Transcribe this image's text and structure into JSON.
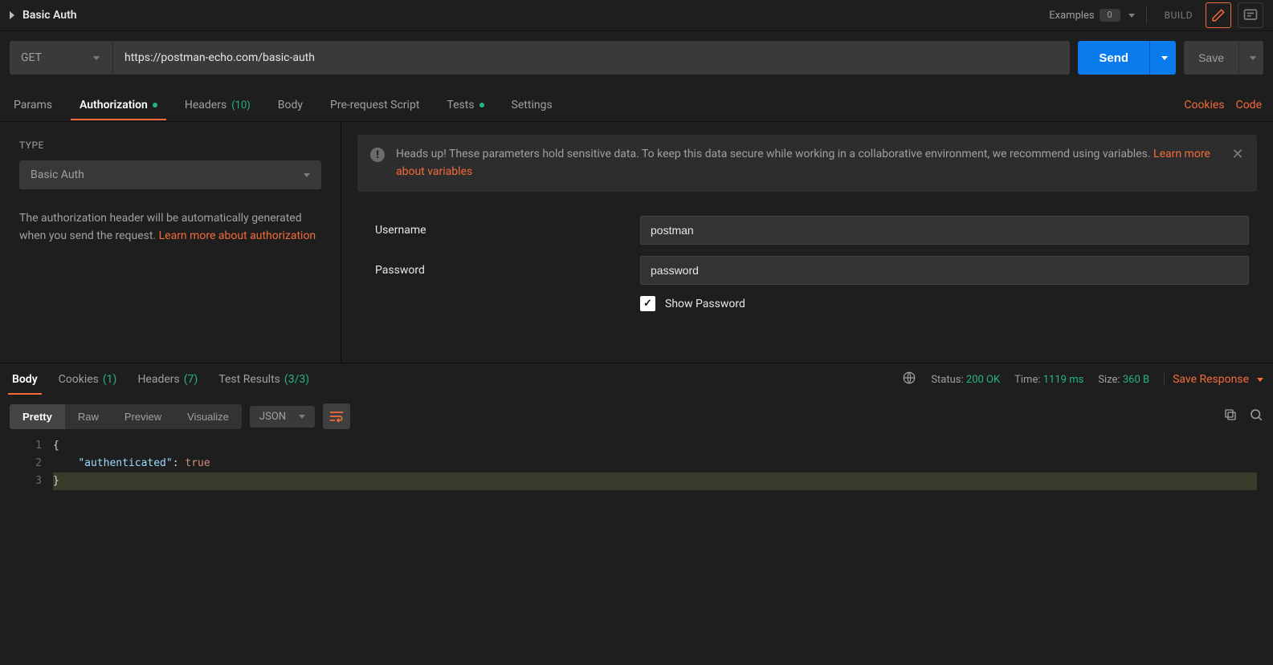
{
  "titlebar": {
    "request_name": "Basic Auth",
    "examples_label": "Examples",
    "examples_count": "0",
    "build": "BUILD"
  },
  "url_row": {
    "method": "GET",
    "url": "https://postman-echo.com/basic-auth",
    "send": "Send",
    "save": "Save"
  },
  "req_tabs": {
    "params": "Params",
    "authorization": "Authorization",
    "headers": "Headers",
    "headers_count": "(10)",
    "body": "Body",
    "prerequest": "Pre-request Script",
    "tests": "Tests",
    "settings": "Settings",
    "cookies": "Cookies",
    "code": "Code"
  },
  "auth_panel": {
    "type_label": "TYPE",
    "type_value": "Basic Auth",
    "help_text": "The authorization header will be automatically generated when you send the request. ",
    "learn_more": "Learn more about authorization"
  },
  "warning": {
    "text": "Heads up! These parameters hold sensitive data. To keep this data secure while working in a collaborative environment, we recommend using variables. ",
    "link": "Learn more about variables"
  },
  "form": {
    "username_label": "Username",
    "username_value": "postman",
    "password_label": "Password",
    "password_value": "password",
    "show_password": "Show Password"
  },
  "resp_tabs": {
    "body": "Body",
    "cookies": "Cookies",
    "cookies_count": "(1)",
    "headers": "Headers",
    "headers_count": "(7)",
    "tests": "Test Results",
    "tests_count": "(3/3)"
  },
  "resp_meta": {
    "status_k": "Status:",
    "status_v": "200 OK",
    "time_k": "Time:",
    "time_v": "1119 ms",
    "size_k": "Size:",
    "size_v": "360 B",
    "save_response": "Save Response"
  },
  "body_toolbar": {
    "pretty": "Pretty",
    "raw": "Raw",
    "preview": "Preview",
    "visualize": "Visualize",
    "format": "JSON"
  },
  "code": {
    "line1": "{",
    "line2_key": "\"authenticated\"",
    "line2_colon": ": ",
    "line2_val": "true",
    "line3": "}",
    "ln1": "1",
    "ln2": "2",
    "ln3": "3"
  }
}
